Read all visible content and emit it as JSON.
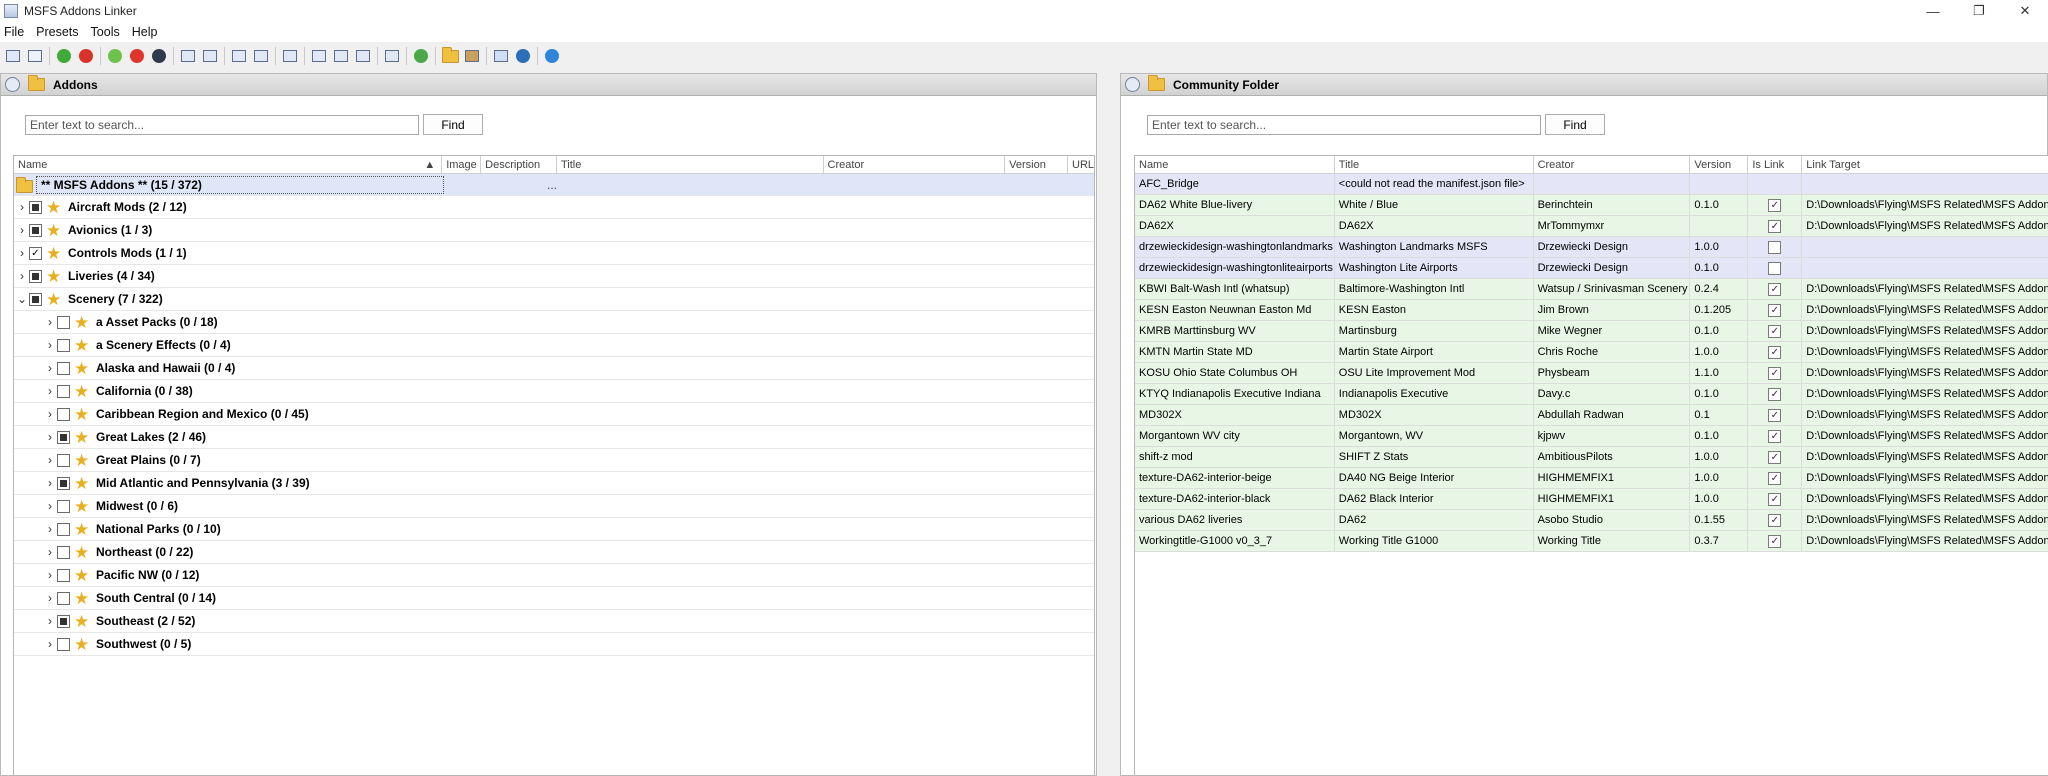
{
  "window": {
    "title": "MSFS Addons Linker",
    "min": "—",
    "restore": "❐",
    "close": "✕"
  },
  "menu": [
    "File",
    "Presets",
    "Tools",
    "Help"
  ],
  "addons_panel": {
    "title": "Addons",
    "search_placeholder": "Enter text to search...",
    "find_label": "Find",
    "columns": [
      "Name",
      "Image",
      "Description",
      "Title",
      "Creator",
      "Version",
      "URL"
    ],
    "root": {
      "label": "** MSFS Addons ** (15 / 372)",
      "description": "..."
    },
    "groups": [
      {
        "label": "Aircraft Mods (2 / 12)",
        "expander": "›",
        "state": "indet"
      },
      {
        "label": "Avionics (1 / 3)",
        "expander": "›",
        "state": "indet"
      },
      {
        "label": "Controls Mods (1 / 1)",
        "expander": "›",
        "state": "checked"
      },
      {
        "label": "Liveries (4 / 34)",
        "expander": "›",
        "state": "indet"
      },
      {
        "label": "Scenery (7 / 322)",
        "expander": "⌄",
        "state": "indet"
      }
    ],
    "scenery_children": [
      {
        "label": "a Asset Packs (0 / 18)",
        "state": "empty"
      },
      {
        "label": "a Scenery Effects (0 / 4)",
        "state": "empty"
      },
      {
        "label": "Alaska and Hawaii (0 / 4)",
        "state": "empty"
      },
      {
        "label": "California (0 / 38)",
        "state": "empty"
      },
      {
        "label": "Caribbean Region and Mexico (0 / 45)",
        "state": "empty"
      },
      {
        "label": "Great Lakes (2 / 46)",
        "state": "indet"
      },
      {
        "label": "Great Plains (0 / 7)",
        "state": "empty"
      },
      {
        "label": "Mid Atlantic and Pennsylvania (3 / 39)",
        "state": "indet"
      },
      {
        "label": "Midwest (0 / 6)",
        "state": "empty"
      },
      {
        "label": "National Parks (0 / 10)",
        "state": "empty"
      },
      {
        "label": "Northeast (0 / 22)",
        "state": "empty"
      },
      {
        "label": "Pacific NW (0 / 12)",
        "state": "empty"
      },
      {
        "label": "South Central (0 / 14)",
        "state": "empty"
      },
      {
        "label": "Southeast (2 / 52)",
        "state": "indet"
      },
      {
        "label": "Southwest (0 / 5)",
        "state": "empty"
      }
    ]
  },
  "community_panel": {
    "title": "Community Folder",
    "search_placeholder": "Enter text to search...",
    "find_label": "Find",
    "columns": [
      "Name",
      "Title",
      "Creator",
      "Version",
      "Is Link",
      "Link Target"
    ],
    "rows": [
      {
        "name": "AFC_Bridge",
        "title": "<could not read the manifest.json file>",
        "creator": "",
        "version": "",
        "is_link": null,
        "target": "",
        "color": "purple"
      },
      {
        "name": "DA62 White Blue-livery",
        "title": "White / Blue",
        "creator": "Berinchtein",
        "version": "0.1.0",
        "is_link": true,
        "target": "D:\\Downloads\\Flying\\MSFS Related\\MSFS Addons",
        "color": "green"
      },
      {
        "name": "DA62X",
        "title": "DA62X",
        "creator": "MrTommymxr",
        "version": "",
        "is_link": true,
        "target": "D:\\Downloads\\Flying\\MSFS Related\\MSFS Addons",
        "color": "green"
      },
      {
        "name": "drzewieckidesign-washingtonlandmarks",
        "title": "Washington Landmarks MSFS",
        "creator": "Drzewiecki Design",
        "version": "1.0.0",
        "is_link": false,
        "target": "",
        "color": "purple"
      },
      {
        "name": "drzewieckidesign-washingtonliteairports",
        "title": "Washington Lite Airports",
        "creator": "Drzewiecki Design",
        "version": "0.1.0",
        "is_link": false,
        "target": "",
        "color": "purple"
      },
      {
        "name": "KBWI Balt-Wash Intl (whatsup)",
        "title": "Baltimore-Washington Intl",
        "creator": "Watsup / Srinivasman Scenery",
        "version": "0.2.4",
        "is_link": true,
        "target": "D:\\Downloads\\Flying\\MSFS Related\\MSFS Addons",
        "color": "green"
      },
      {
        "name": "KESN Easton Neuwnan Easton Md",
        "title": "KESN Easton",
        "creator": "Jim Brown",
        "version": "0.1.205",
        "is_link": true,
        "target": "D:\\Downloads\\Flying\\MSFS Related\\MSFS Addons",
        "color": "green"
      },
      {
        "name": "KMRB Marttinsburg WV",
        "title": "Martinsburg",
        "creator": "Mike Wegner",
        "version": "0.1.0",
        "is_link": true,
        "target": "D:\\Downloads\\Flying\\MSFS Related\\MSFS Addons",
        "color": "green"
      },
      {
        "name": "KMTN Martin State MD",
        "title": "Martin State Airport",
        "creator": "Chris Roche",
        "version": "1.0.0",
        "is_link": true,
        "target": "D:\\Downloads\\Flying\\MSFS Related\\MSFS Addons",
        "color": "green"
      },
      {
        "name": "KOSU Ohio State Columbus OH",
        "title": "OSU Lite Improvement Mod",
        "creator": "Physbeam",
        "version": "1.1.0",
        "is_link": true,
        "target": "D:\\Downloads\\Flying\\MSFS Related\\MSFS Addons",
        "color": "green"
      },
      {
        "name": "KTYQ Indianapolis Executive Indiana",
        "title": "Indianapolis Executive",
        "creator": "Davy.c",
        "version": "0.1.0",
        "is_link": true,
        "target": "D:\\Downloads\\Flying\\MSFS Related\\MSFS Addons",
        "color": "green"
      },
      {
        "name": "MD302X",
        "title": "MD302X",
        "creator": "Abdullah Radwan",
        "version": "0.1",
        "is_link": true,
        "target": "D:\\Downloads\\Flying\\MSFS Related\\MSFS Addons",
        "color": "green"
      },
      {
        "name": "Morgantown WV city",
        "title": "Morgantown, WV",
        "creator": "kjpwv",
        "version": "0.1.0",
        "is_link": true,
        "target": "D:\\Downloads\\Flying\\MSFS Related\\MSFS Addons",
        "color": "green"
      },
      {
        "name": "shift-z mod",
        "title": "SHIFT Z Stats",
        "creator": "AmbitiousPilots",
        "version": "1.0.0",
        "is_link": true,
        "target": "D:\\Downloads\\Flying\\MSFS Related\\MSFS Addons",
        "color": "green"
      },
      {
        "name": "texture-DA62-interior-beige",
        "title": "DA40 NG Beige Interior",
        "creator": "HIGHMEMFIX1",
        "version": "1.0.0",
        "is_link": true,
        "target": "D:\\Downloads\\Flying\\MSFS Related\\MSFS Addons",
        "color": "green"
      },
      {
        "name": "texture-DA62-interior-black",
        "title": "DA62 Black Interior",
        "creator": "HIGHMEMFIX1",
        "version": "1.0.0",
        "is_link": true,
        "target": "D:\\Downloads\\Flying\\MSFS Related\\MSFS Addons",
        "color": "green"
      },
      {
        "name": "various DA62 liveries",
        "title": "DA62",
        "creator": "Asobo Studio",
        "version": "0.1.55",
        "is_link": true,
        "target": "D:\\Downloads\\Flying\\MSFS Related\\MSFS Addons",
        "color": "green"
      },
      {
        "name": "Workingtitle-G1000 v0_3_7",
        "title": "Working Title G1000",
        "creator": "Working Title",
        "version": "0.3.7",
        "is_link": true,
        "target": "D:\\Downloads\\Flying\\MSFS Related\\MSFS Addons",
        "color": "green"
      }
    ]
  },
  "colors": {
    "row_green": "#e8f7e5",
    "row_purple": "#e4e5f6",
    "root_highlight": "#dfe6f7",
    "star": "#e8b020"
  }
}
